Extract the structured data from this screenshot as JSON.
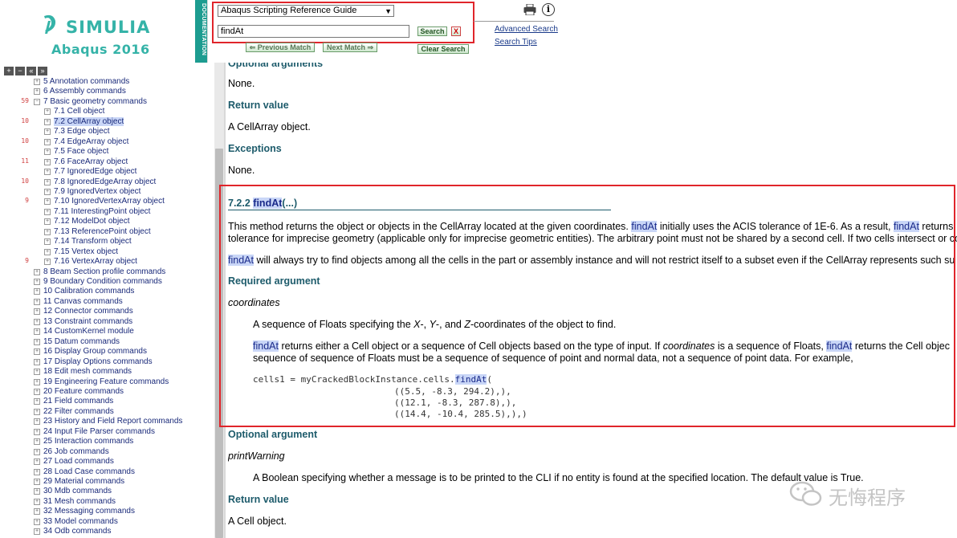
{
  "header": {
    "brand_name": "SIMULIA",
    "product": "Abaqus 2016",
    "doc_strip": "DOCUMENTATION",
    "guide_select": "Abaqus Scripting Reference Guide",
    "search_value": "findAt",
    "search_label": "Search",
    "clear_x": "X",
    "prev_match": "Previous Match",
    "next_match": "Next Match",
    "clear_search": "Clear Search",
    "advanced_search": "Advanced Search",
    "search_tips": "Search Tips",
    "info": "i"
  },
  "tree_toolbar": [
    "+",
    "−",
    "«",
    "»"
  ],
  "tree": [
    {
      "num": "",
      "label": "5 Annotation commands",
      "level": 1,
      "selected": false
    },
    {
      "num": "",
      "label": "6 Assembly commands",
      "level": 1,
      "selected": false
    },
    {
      "num": "59",
      "label": "7 Basic geometry commands",
      "level": 1,
      "selected": false
    },
    {
      "num": "",
      "label": "7.1 Cell object",
      "level": 2,
      "selected": false
    },
    {
      "num": "10",
      "label": "7.2 CellArray object",
      "level": 2,
      "selected": true
    },
    {
      "num": "",
      "label": "7.3 Edge object",
      "level": 2,
      "selected": false
    },
    {
      "num": "10",
      "label": "7.4 EdgeArray object",
      "level": 2,
      "selected": false
    },
    {
      "num": "",
      "label": "7.5 Face object",
      "level": 2,
      "selected": false
    },
    {
      "num": "11",
      "label": "7.6 FaceArray object",
      "level": 2,
      "selected": false
    },
    {
      "num": "",
      "label": "7.7 IgnoredEdge object",
      "level": 2,
      "selected": false
    },
    {
      "num": "10",
      "label": "7.8 IgnoredEdgeArray object",
      "level": 2,
      "selected": false
    },
    {
      "num": "",
      "label": "7.9 IgnoredVertex object",
      "level": 2,
      "selected": false
    },
    {
      "num": "9",
      "label": "7.10 IgnoredVertexArray object",
      "level": 2,
      "selected": false
    },
    {
      "num": "",
      "label": "7.11 InterestingPoint object",
      "level": 2,
      "selected": false
    },
    {
      "num": "",
      "label": "7.12 ModelDot object",
      "level": 2,
      "selected": false
    },
    {
      "num": "",
      "label": "7.13 ReferencePoint object",
      "level": 2,
      "selected": false
    },
    {
      "num": "",
      "label": "7.14 Transform object",
      "level": 2,
      "selected": false
    },
    {
      "num": "",
      "label": "7.15 Vertex object",
      "level": 2,
      "selected": false
    },
    {
      "num": "9",
      "label": "7.16 VertexArray object",
      "level": 2,
      "selected": false
    },
    {
      "num": "",
      "label": "8 Beam Section profile commands",
      "level": 1,
      "selected": false
    },
    {
      "num": "",
      "label": "9 Boundary Condition commands",
      "level": 1,
      "selected": false
    },
    {
      "num": "",
      "label": "10 Calibration commands",
      "level": 1,
      "selected": false
    },
    {
      "num": "",
      "label": "11 Canvas commands",
      "level": 1,
      "selected": false
    },
    {
      "num": "",
      "label": "12 Connector commands",
      "level": 1,
      "selected": false
    },
    {
      "num": "",
      "label": "13 Constraint commands",
      "level": 1,
      "selected": false
    },
    {
      "num": "",
      "label": "14 CustomKernel module",
      "level": 1,
      "selected": false
    },
    {
      "num": "",
      "label": "15 Datum commands",
      "level": 1,
      "selected": false
    },
    {
      "num": "",
      "label": "16 Display Group commands",
      "level": 1,
      "selected": false
    },
    {
      "num": "",
      "label": "17 Display Options commands",
      "level": 1,
      "selected": false
    },
    {
      "num": "",
      "label": "18 Edit mesh commands",
      "level": 1,
      "selected": false
    },
    {
      "num": "",
      "label": "19 Engineering Feature commands",
      "level": 1,
      "selected": false
    },
    {
      "num": "",
      "label": "20 Feature commands",
      "level": 1,
      "selected": false
    },
    {
      "num": "",
      "label": "21 Field commands",
      "level": 1,
      "selected": false
    },
    {
      "num": "",
      "label": "22 Filter commands",
      "level": 1,
      "selected": false
    },
    {
      "num": "",
      "label": "23 History and Field Report commands",
      "level": 1,
      "selected": false
    },
    {
      "num": "",
      "label": "24 Input File Parser commands",
      "level": 1,
      "selected": false
    },
    {
      "num": "",
      "label": "25 Interaction commands",
      "level": 1,
      "selected": false
    },
    {
      "num": "",
      "label": "26 Job commands",
      "level": 1,
      "selected": false
    },
    {
      "num": "",
      "label": "27 Load commands",
      "level": 1,
      "selected": false
    },
    {
      "num": "",
      "label": "28 Load Case commands",
      "level": 1,
      "selected": false
    },
    {
      "num": "",
      "label": "29 Material commands",
      "level": 1,
      "selected": false
    },
    {
      "num": "",
      "label": "30 Mdb commands",
      "level": 1,
      "selected": false
    },
    {
      "num": "",
      "label": "31 Mesh commands",
      "level": 1,
      "selected": false
    },
    {
      "num": "",
      "label": "32 Messaging commands",
      "level": 1,
      "selected": false
    },
    {
      "num": "",
      "label": "33 Model commands",
      "level": 1,
      "selected": false
    },
    {
      "num": "",
      "label": "34 Odb commands",
      "level": 1,
      "selected": false
    }
  ],
  "content": {
    "optional_arguments_partial": "Optional arguments",
    "none_1": "None.",
    "return_value_heading": "Return value",
    "return_value_text": "A CellArray object.",
    "exceptions_heading": "Exceptions",
    "none_2": "None.",
    "section_number": "7.2.2",
    "section_name": "findAt",
    "section_suffix": "(...)",
    "para1_a": "This method returns the object or objects in the CellArray located at the given coordinates.",
    "para1_b": "initially uses the ACIS tolerance of 1E-6. As a result,",
    "para1_c": "returns",
    "para1_line2": "tolerance for imprecise geometry (applicable only for imprecise geometric entities). The arbitrary point must not be shared by a second cell. If two cells intersect or co",
    "para2": "will always try to find objects among all the cells in the part or assembly instance and will not restrict itself to a subset even if the CellArray represents such su",
    "required_heading": "Required argument",
    "coordinates_name": "coordinates",
    "coordinates_desc_a": "A sequence of Floats specifying the ",
    "coordinates_desc_x": "X",
    "coordinates_desc_y": "Y",
    "coordinates_desc_z": "Z",
    "coordinates_desc_b": "-coordinates of the object to find.",
    "returns_a": "returns either a Cell object or a sequence of Cell objects based on the type of input. If",
    "returns_coordinates": "coordinates",
    "returns_b": "is a sequence of Floats,",
    "returns_c": "returns the Cell objec",
    "returns_line2": "sequence of sequence of Floats must be a sequence of sequence of point and normal data, not a sequence of point data. For example,",
    "code_1": "cells1 = myCrackedBlockInstance.cells.",
    "code_1b": "(",
    "code_2": "((5.5, -8.3, 294.2),),",
    "code_3": "((12.1, -8.3, 287.8),),",
    "code_4": "((14.4, -10.4, 285.5),),)",
    "optional_heading": "Optional argument",
    "print_warning_name": "printWarning",
    "print_warning_desc": "A Boolean specifying whether a message is to be printed to the CLI if no entity is found at the specified location. The default value is True.",
    "return_heading_2": "Return value",
    "return_text_2": "A Cell object."
  },
  "watermark": "无悔程序"
}
